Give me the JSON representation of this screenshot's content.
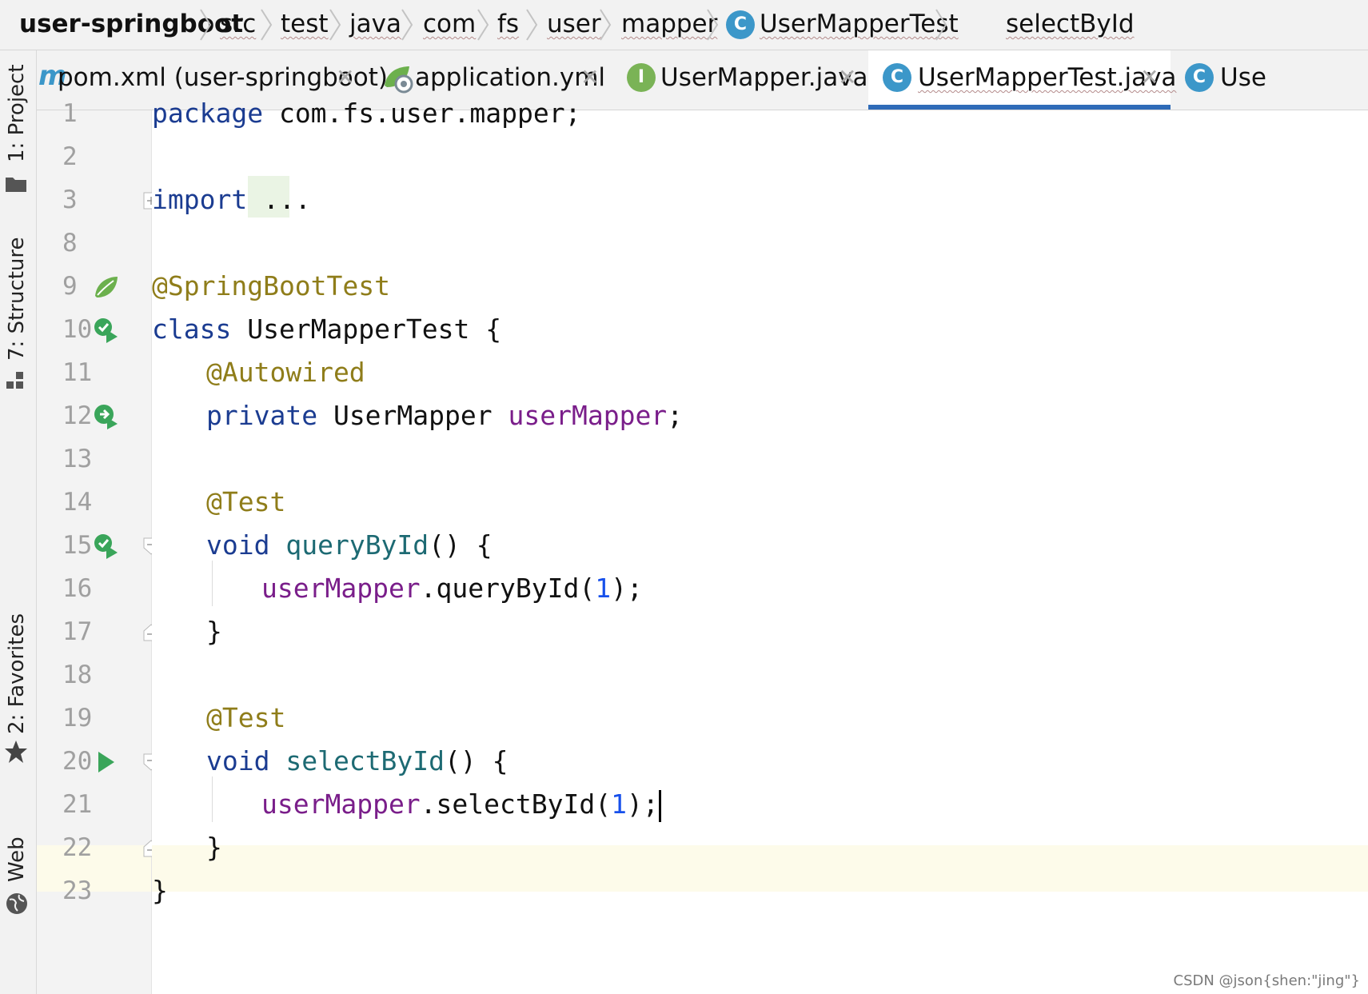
{
  "breadcrumb": [
    "user-springboot",
    "src",
    "test",
    "java",
    "com",
    "fs",
    "user",
    "mapper",
    "UserMapperTest",
    "selectById"
  ],
  "sidebar": {
    "project": "1: Project",
    "structure": "7: Structure",
    "favorites": "2: Favorites",
    "web": "Web"
  },
  "tabs": [
    {
      "label": "pom.xml (user-springboot)",
      "icon": "maven-icon",
      "active": false
    },
    {
      "label": "application.yml",
      "icon": "spring-config-icon",
      "active": false
    },
    {
      "label": "UserMapper.java",
      "icon": "interface-icon",
      "active": false
    },
    {
      "label": "UserMapperTest.java",
      "icon": "class-icon",
      "active": true
    },
    {
      "label": "Use",
      "icon": "class-icon",
      "active": false
    }
  ],
  "icon_letters": {
    "class": "C",
    "interface": "I"
  },
  "line_numbers": [
    "1",
    "2",
    "3",
    "8",
    "9",
    "10",
    "11",
    "12",
    "13",
    "14",
    "15",
    "16",
    "17",
    "18",
    "19",
    "20",
    "21",
    "22",
    "23"
  ],
  "code": {
    "l1_kw": "package",
    "l1_rest": " com.fs.user.mapper;",
    "l3_kw": "import",
    "l3_rest": " ...",
    "l9": "@SpringBootTest",
    "l10_kw": "class",
    "l10_rest": " UserMapperTest {",
    "l11": "@Autowired",
    "l12_kw": "private",
    "l12_type": " UserMapper ",
    "l12_fld": "userMapper",
    "l12_end": ";",
    "l14": "@Test",
    "l15_kw": "void",
    "l15_mth": " queryById",
    "l15_end": "() {",
    "l16_fld": "userMapper",
    "l16_call": ".queryById(",
    "l16_num": "1",
    "l16_end": ");",
    "l17": "}",
    "l19": "@Test",
    "l20_kw": "void",
    "l20_mth": " selectById",
    "l20_end": "() {",
    "l21_fld": "userMapper",
    "l21_call": ".selectById(",
    "l21_num": "1",
    "l21_end": ");",
    "l22": "}",
    "l23": "}"
  },
  "watermark": "CSDN @json{shen:\"jing\"}",
  "colors": {
    "accent": "#2f6bb8",
    "keyword": "#1b3c91",
    "annotation": "#8f7d1a",
    "field": "#7a1e8a",
    "run": "#3aa55a"
  }
}
